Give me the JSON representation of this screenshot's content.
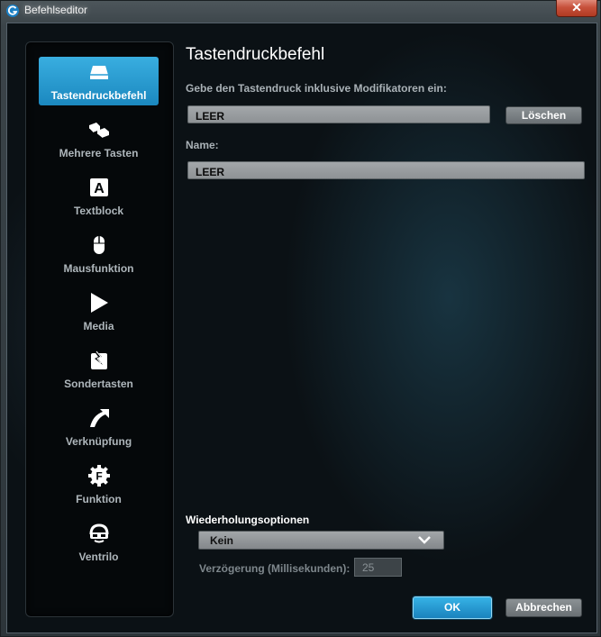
{
  "window": {
    "title": "Befehlseditor",
    "close_glyph": "✕"
  },
  "sidebar": {
    "items": [
      {
        "label": "Tastendruckbefehl",
        "icon": "key-icon",
        "active": true
      },
      {
        "label": "Mehrere Tasten",
        "icon": "multiple-keys-icon",
        "active": false
      },
      {
        "label": "Textblock",
        "icon": "text-block-icon",
        "icon_glyph": "A",
        "active": false
      },
      {
        "label": "Mausfunktion",
        "icon": "mouse-icon",
        "active": false
      },
      {
        "label": "Media",
        "icon": "play-icon",
        "active": false
      },
      {
        "label": "Sondertasten",
        "icon": "special-key-icon",
        "active": false
      },
      {
        "label": "Verknüpfung",
        "icon": "shortcut-arrow-icon",
        "active": false
      },
      {
        "label": "Funktion",
        "icon": "function-gear-icon",
        "icon_glyph": "F",
        "active": false
      },
      {
        "label": "Ventrilo",
        "icon": "ventrilo-icon",
        "active": false
      }
    ]
  },
  "main": {
    "title": "Tastendruckbefehl",
    "keystroke_label": "Gebe den Tastendruck inklusive Modifikatoren ein:",
    "keystroke_value": "LEER",
    "clear_button": "Löschen",
    "name_label": "Name:",
    "name_value": "LEER"
  },
  "repeat": {
    "heading": "Wiederholungsoptionen",
    "selected": "Kein",
    "delay_label": "Verzögerung (Millisekunden):",
    "delay_value": "25"
  },
  "footer": {
    "ok": "OK",
    "cancel": "Abbrechen"
  },
  "colors": {
    "accent": "#2a9dd6",
    "background": "#0b1115",
    "sidebar": "#05080a"
  }
}
